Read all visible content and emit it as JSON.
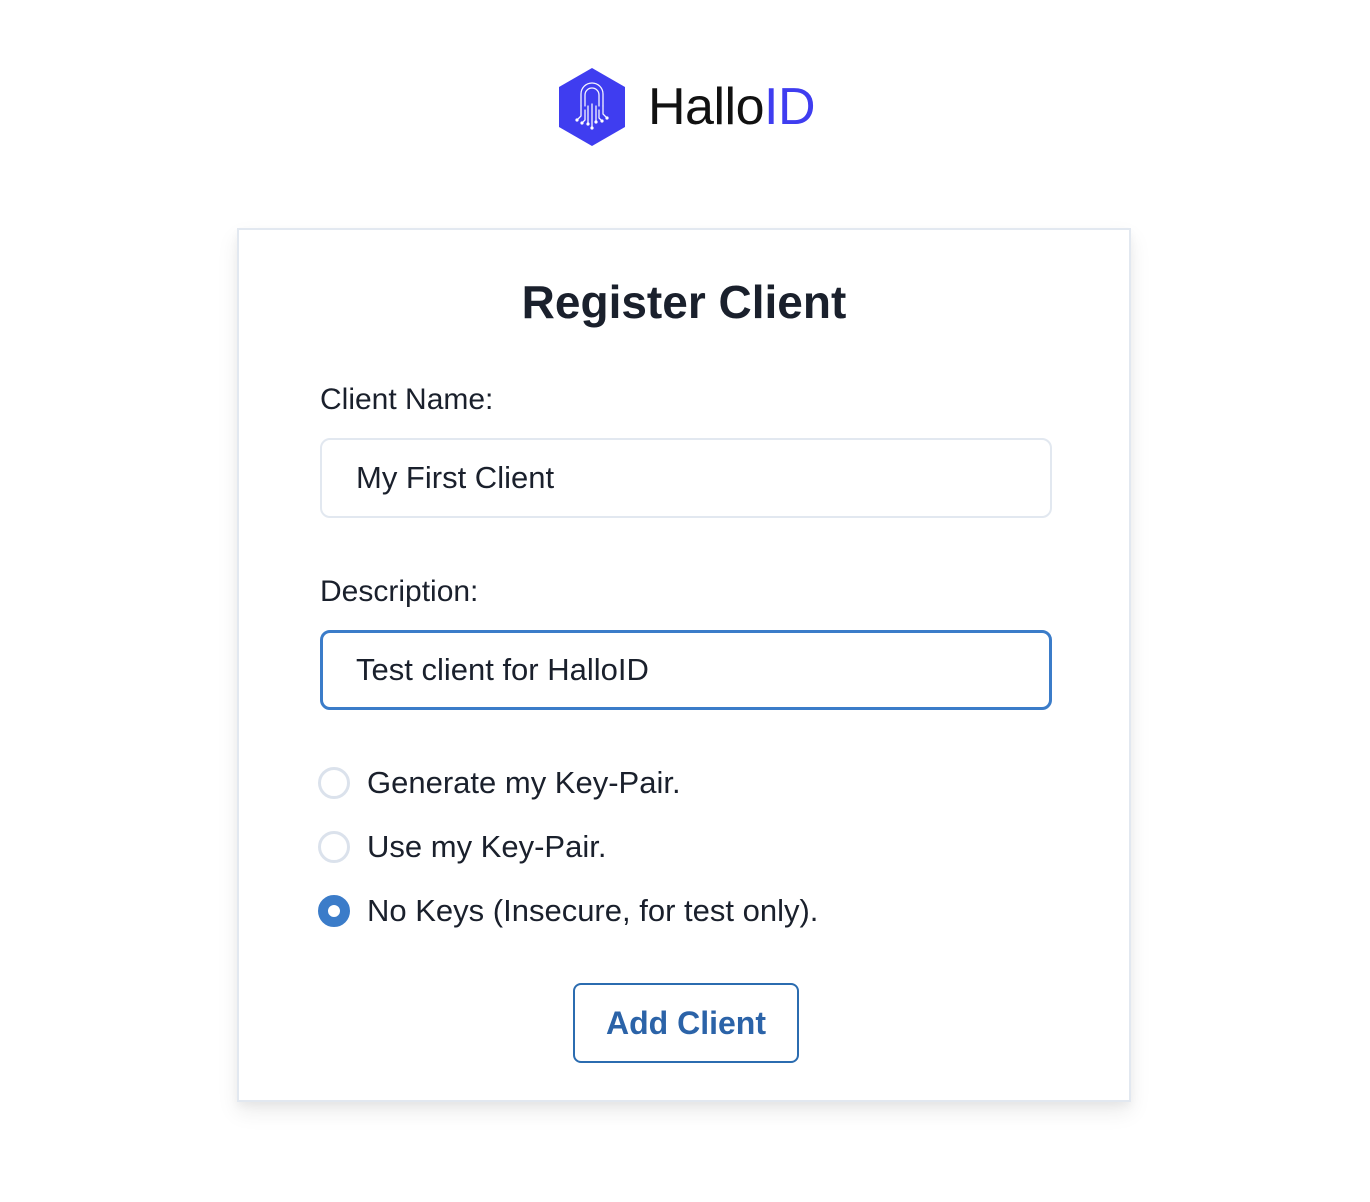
{
  "brand": {
    "name_prefix": "Hallo",
    "name_accent": "ID",
    "logo_icon": "hexagon-padlock-circuit-icon",
    "accent_color": "#3f3df0"
  },
  "form": {
    "title": "Register Client",
    "client_name": {
      "label": "Client Name:",
      "value": "My First Client"
    },
    "description": {
      "label": "Description:",
      "value": "Test client for HalloID"
    },
    "key_options": [
      {
        "label": "Generate my Key-Pair.",
        "checked": false
      },
      {
        "label": "Use my Key-Pair.",
        "checked": false
      },
      {
        "label": "No Keys (Insecure, for test only).",
        "checked": true
      }
    ],
    "submit_label": "Add Client",
    "focus_color": "#3b7cc9",
    "button_color": "#2b6cb0"
  }
}
